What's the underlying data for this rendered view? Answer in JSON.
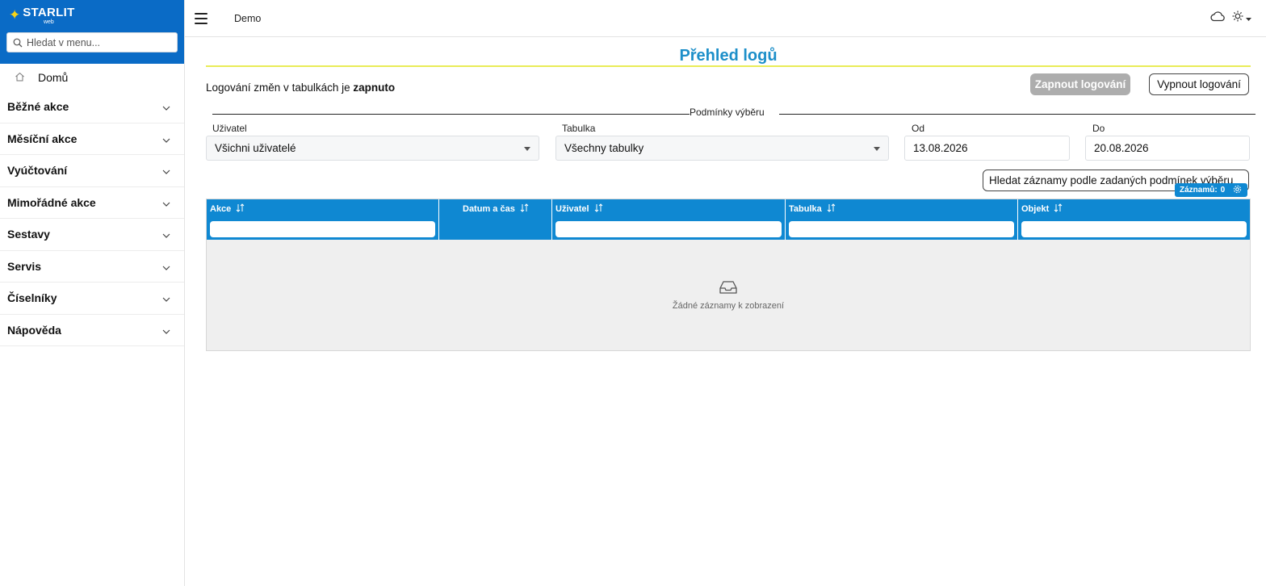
{
  "brand": {
    "name": "STARLIT",
    "sub": "web"
  },
  "sidebar": {
    "search_placeholder": "Hledat v menu...",
    "home_label": "Domů",
    "items": [
      {
        "label": "Běžné akce"
      },
      {
        "label": "Měsíční akce"
      },
      {
        "label": "Vyúčtování"
      },
      {
        "label": "Mimořádné akce"
      },
      {
        "label": "Sestavy"
      },
      {
        "label": "Servis"
      },
      {
        "label": "Číselníky"
      },
      {
        "label": "Nápověda"
      }
    ]
  },
  "topbar": {
    "context": "Demo",
    "icons": [
      "menu-icon",
      "cloud-icon",
      "sun-icon",
      "caret-down-icon"
    ]
  },
  "page": {
    "title": "Přehled logů",
    "status_prefix": "Logování změn v tabulkách je ",
    "status_value": "zapnuto",
    "btn_enable": "Zapnout logování",
    "btn_disable": "Vypnout logování"
  },
  "filters": {
    "legend": "Podmínky výběru",
    "user_label": "Uživatel",
    "user_value": "Všichni uživatelé",
    "table_label": "Tabulka",
    "table_value": "Všechny tabulky",
    "from_label": "Od",
    "from_value": "13.08.2026",
    "to_label": "Do",
    "to_value": "20.08.2026",
    "search_button": "Hledat záznamy podle zadaných podmínek výběru"
  },
  "grid": {
    "count_label": "Záznamů:",
    "count_value": "0",
    "columns": [
      {
        "label": "Akce"
      },
      {
        "label": "Datum a čas"
      },
      {
        "label": "Uživatel"
      },
      {
        "label": "Tabulka"
      },
      {
        "label": "Objekt"
      }
    ],
    "empty_text": "Žádné záznamy k zobrazení"
  },
  "colors": {
    "brand": "#0a6bc6",
    "accent": "#1d8fc9",
    "grid_header": "#0f88d2",
    "title_underline": "#e9ec58",
    "star": "#f7d417"
  }
}
